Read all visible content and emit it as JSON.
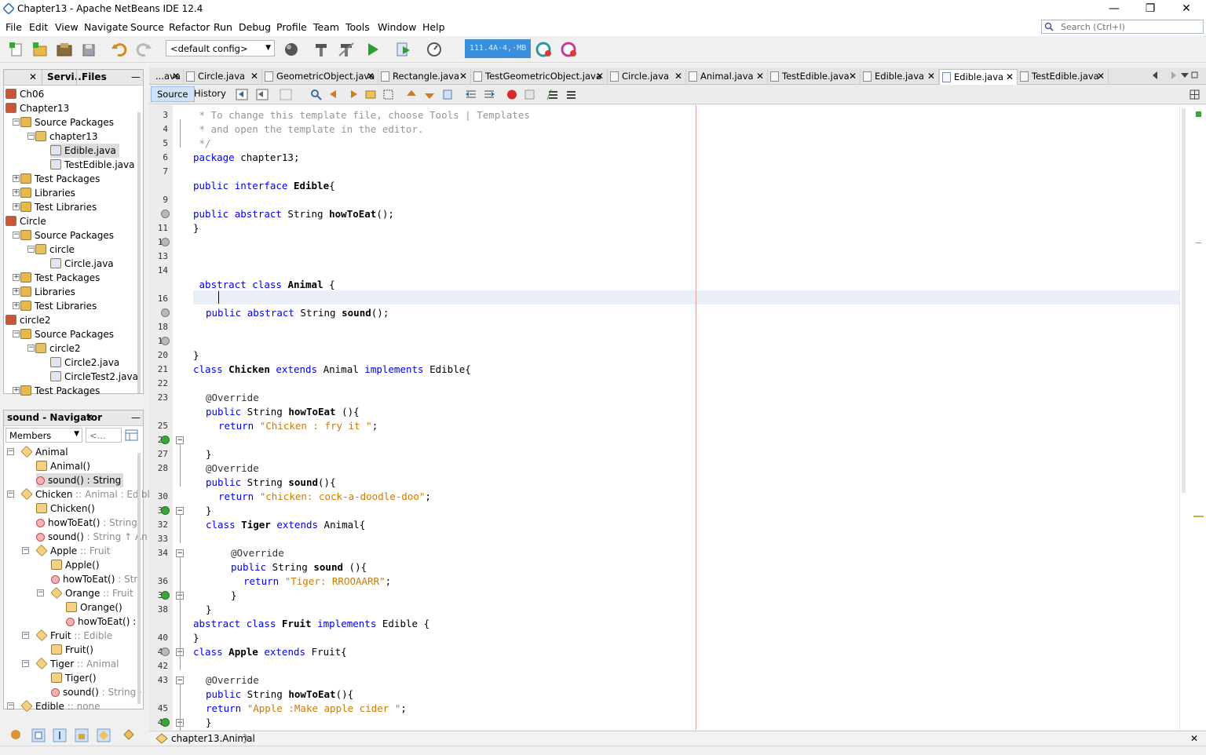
{
  "window": {
    "title": "Chapter13 - Apache NetBeans IDE 12.4",
    "minimize": "—",
    "maximize": "❐",
    "close": "✕"
  },
  "menu": [
    "File",
    "Edit",
    "View",
    "Navigate",
    "Source",
    "Refactor",
    "Run",
    "Debug",
    "Profile",
    "Team",
    "Tools",
    "Window",
    "Help"
  ],
  "search": {
    "placeholder": "Search (Ctrl+I)"
  },
  "toolbar": {
    "config": "<default config>",
    "memory": "111.4A·4,·MB"
  },
  "projects_panel": {
    "tabs": [
      "Servi...",
      "Files"
    ],
    "close": "✕",
    "minimize": "—",
    "tree": [
      {
        "label": "Ch06",
        "level": 0
      },
      {
        "label": "Chapter13",
        "level": 0
      },
      {
        "label": "Source Packages",
        "level": 1
      },
      {
        "label": "chapter13",
        "level": 2
      },
      {
        "label": "Edible.java",
        "level": 3,
        "selected": true
      },
      {
        "label": "TestEdible.java",
        "level": 3
      },
      {
        "label": "Test Packages",
        "level": 1
      },
      {
        "label": "Libraries",
        "level": 1
      },
      {
        "label": "Test Libraries",
        "level": 1
      },
      {
        "label": "Circle",
        "level": 0
      },
      {
        "label": "Source Packages",
        "level": 1
      },
      {
        "label": "circle",
        "level": 2
      },
      {
        "label": "Circle.java",
        "level": 3
      },
      {
        "label": "Test Packages",
        "level": 1
      },
      {
        "label": "Libraries",
        "level": 1
      },
      {
        "label": "Test Libraries",
        "level": 1
      },
      {
        "label": "circle2",
        "level": 0
      },
      {
        "label": "Source Packages",
        "level": 1
      },
      {
        "label": "circle2",
        "level": 2
      },
      {
        "label": "Circle2.java",
        "level": 3
      },
      {
        "label": "CircleTest2.java",
        "level": 3
      },
      {
        "label": "Test Packages",
        "level": 1
      }
    ]
  },
  "navigator": {
    "title": "sound - Navigator",
    "close": "✕",
    "minimize": "—",
    "filter": "Members",
    "filter2": "<...",
    "items": [
      {
        "name": "Animal",
        "suffix": "",
        "level": 0
      },
      {
        "name": "Animal()",
        "suffix": "",
        "level": 1
      },
      {
        "name": "sound() : String",
        "suffix": "",
        "level": 1,
        "selected": true
      },
      {
        "name": "Chicken",
        "suffix": " :: Animal : Edible",
        "level": 0
      },
      {
        "name": "Chicken()",
        "suffix": "",
        "level": 1
      },
      {
        "name": "howToEat()",
        "suffix": " : String",
        "level": 1
      },
      {
        "name": "sound()",
        "suffix": " : String ↑ An",
        "level": 1
      },
      {
        "name": "Apple",
        "suffix": " :: Fruit",
        "level": 1
      },
      {
        "name": "Apple()",
        "suffix": "",
        "level": 2
      },
      {
        "name": "howToEat()",
        "suffix": " : Str",
        "level": 2
      },
      {
        "name": "Orange",
        "suffix": " :: Fruit",
        "level": 2
      },
      {
        "name": "Orange()",
        "suffix": "",
        "level": 3
      },
      {
        "name": "howToEat() :",
        "suffix": "",
        "level": 3
      },
      {
        "name": "Fruit",
        "suffix": " :: Edible",
        "level": 1
      },
      {
        "name": "Fruit()",
        "suffix": "",
        "level": 2
      },
      {
        "name": "Tiger",
        "suffix": " :: Animal",
        "level": 1
      },
      {
        "name": "Tiger()",
        "suffix": "",
        "level": 2
      },
      {
        "name": "sound()",
        "suffix": " : String ·",
        "level": 2
      },
      {
        "name": "Edible",
        "suffix": " :: none",
        "level": 0
      }
    ]
  },
  "editor_tabs": [
    {
      "label": "...ava",
      "close": "✕"
    },
    {
      "label": "Circle.java",
      "close": "✕"
    },
    {
      "label": "GeometricObject.java",
      "close": "✕"
    },
    {
      "label": "Rectangle.java",
      "close": "✕"
    },
    {
      "label": "TestGeometricObject.java",
      "close": "✕"
    },
    {
      "label": "Circle.java",
      "close": "✕"
    },
    {
      "label": "Animal.java",
      "close": "✕"
    },
    {
      "label": "TestEdible.java",
      "close": "✕"
    },
    {
      "label": "Edible.java",
      "close": "✕"
    },
    {
      "label": "Edible.java",
      "close": "✕",
      "active": true
    },
    {
      "label": "TestEdible.java",
      "close": "✕"
    }
  ],
  "editor_modes": {
    "source": "Source",
    "history": "History"
  },
  "code_lines": [
    {
      "n": "3",
      "t": " * To change this template file, choose Tools | Templates",
      "type": "comment",
      "indent": 0
    },
    {
      "n": "4",
      "t": " * and open the template in the editor.",
      "type": "comment",
      "indent": 0
    },
    {
      "n": "5",
      "t": " */",
      "type": "comment",
      "indent": 0
    },
    {
      "n": "6",
      "t": "package chapter13;",
      "type": "code",
      "indent": 0
    },
    {
      "n": "7",
      "t": "",
      "type": "code",
      "indent": 0
    },
    {
      "n": "",
      "t": "public interface Edible{",
      "type": "code",
      "indent": 0
    },
    {
      "n": "9",
      "t": "",
      "type": "code",
      "indent": 0
    },
    {
      "n": "",
      "t": "public abstract String howToEat();",
      "type": "code",
      "indent": 0
    },
    {
      "n": "11",
      "t": "}",
      "type": "code",
      "indent": 0
    },
    {
      "n": "12",
      "t": "",
      "type": "code",
      "indent": 0
    },
    {
      "n": "13",
      "t": "",
      "type": "code",
      "indent": 0
    },
    {
      "n": "14",
      "t": "",
      "type": "code",
      "indent": 0
    },
    {
      "n": "",
      "t": " abstract class Animal {",
      "type": "code",
      "indent": 0
    },
    {
      "n": "16",
      "t": "",
      "type": "code",
      "indent": 0
    },
    {
      "n": "",
      "t": "public abstract String sound();",
      "type": "code",
      "indent": 1
    },
    {
      "n": "18",
      "t": "",
      "type": "code",
      "indent": 0
    },
    {
      "n": "19",
      "t": "",
      "type": "code",
      "indent": 0
    },
    {
      "n": "20",
      "t": "}",
      "type": "code",
      "indent": 0
    },
    {
      "n": "21",
      "t": "class Chicken extends Animal implements Edible{",
      "type": "code",
      "indent": 0
    },
    {
      "n": "22",
      "t": "",
      "type": "code",
      "indent": 0
    },
    {
      "n": "23",
      "t": "@Override",
      "type": "code",
      "indent": 1
    },
    {
      "n": "",
      "t": "public String howToEat (){",
      "type": "code",
      "indent": 1
    },
    {
      "n": "25",
      "t": "return \"Chicken : fry it \";",
      "type": "code",
      "indent": 2
    },
    {
      "n": "26",
      "t": "",
      "type": "code",
      "indent": 0
    },
    {
      "n": "27",
      "t": "}",
      "type": "code",
      "indent": 1
    },
    {
      "n": "28",
      "t": "@Override",
      "type": "code",
      "indent": 1
    },
    {
      "n": "",
      "t": "public String sound(){",
      "type": "code",
      "indent": 1
    },
    {
      "n": "30",
      "t": "return \"chicken: cock-a-doodle-doo\";",
      "type": "code",
      "indent": 2
    },
    {
      "n": "31",
      "t": "}",
      "type": "code",
      "indent": 1
    },
    {
      "n": "32",
      "t": "class Tiger extends Animal{",
      "type": "code",
      "indent": 1
    },
    {
      "n": "33",
      "t": "",
      "type": "code",
      "indent": 0
    },
    {
      "n": "34",
      "t": "@Override",
      "type": "code",
      "indent": 3
    },
    {
      "n": "",
      "t": "public String sound (){",
      "type": "code",
      "indent": 3
    },
    {
      "n": "36",
      "t": "return \"Tiger: RROOAARR\";",
      "type": "code",
      "indent": 4
    },
    {
      "n": "37",
      "t": "}",
      "type": "code",
      "indent": 3
    },
    {
      "n": "38",
      "t": "}",
      "type": "code",
      "indent": 1
    },
    {
      "n": "",
      "t": "abstract class Fruit implements Edible {",
      "type": "code",
      "indent": 0
    },
    {
      "n": "40",
      "t": "}",
      "type": "code",
      "indent": 0
    },
    {
      "n": "41",
      "t": "class Apple extends Fruit{",
      "type": "code",
      "indent": 0
    },
    {
      "n": "42",
      "t": "",
      "type": "code",
      "indent": 0
    },
    {
      "n": "43",
      "t": "@Override",
      "type": "code",
      "indent": 1
    },
    {
      "n": "",
      "t": "public String howToEat(){",
      "type": "code",
      "indent": 1
    },
    {
      "n": "45",
      "t": "return \"Apple :Make apple cider \";",
      "type": "code",
      "indent": 1
    },
    {
      "n": "46",
      "t": "}",
      "type": "code",
      "indent": 1
    }
  ],
  "breadcrumb": {
    "path": "chapter13.Animal"
  },
  "colors": {
    "accent": "#3a8fdc",
    "keyword": "#0000e6",
    "string": "#ce7b00",
    "comment": "#969696"
  }
}
